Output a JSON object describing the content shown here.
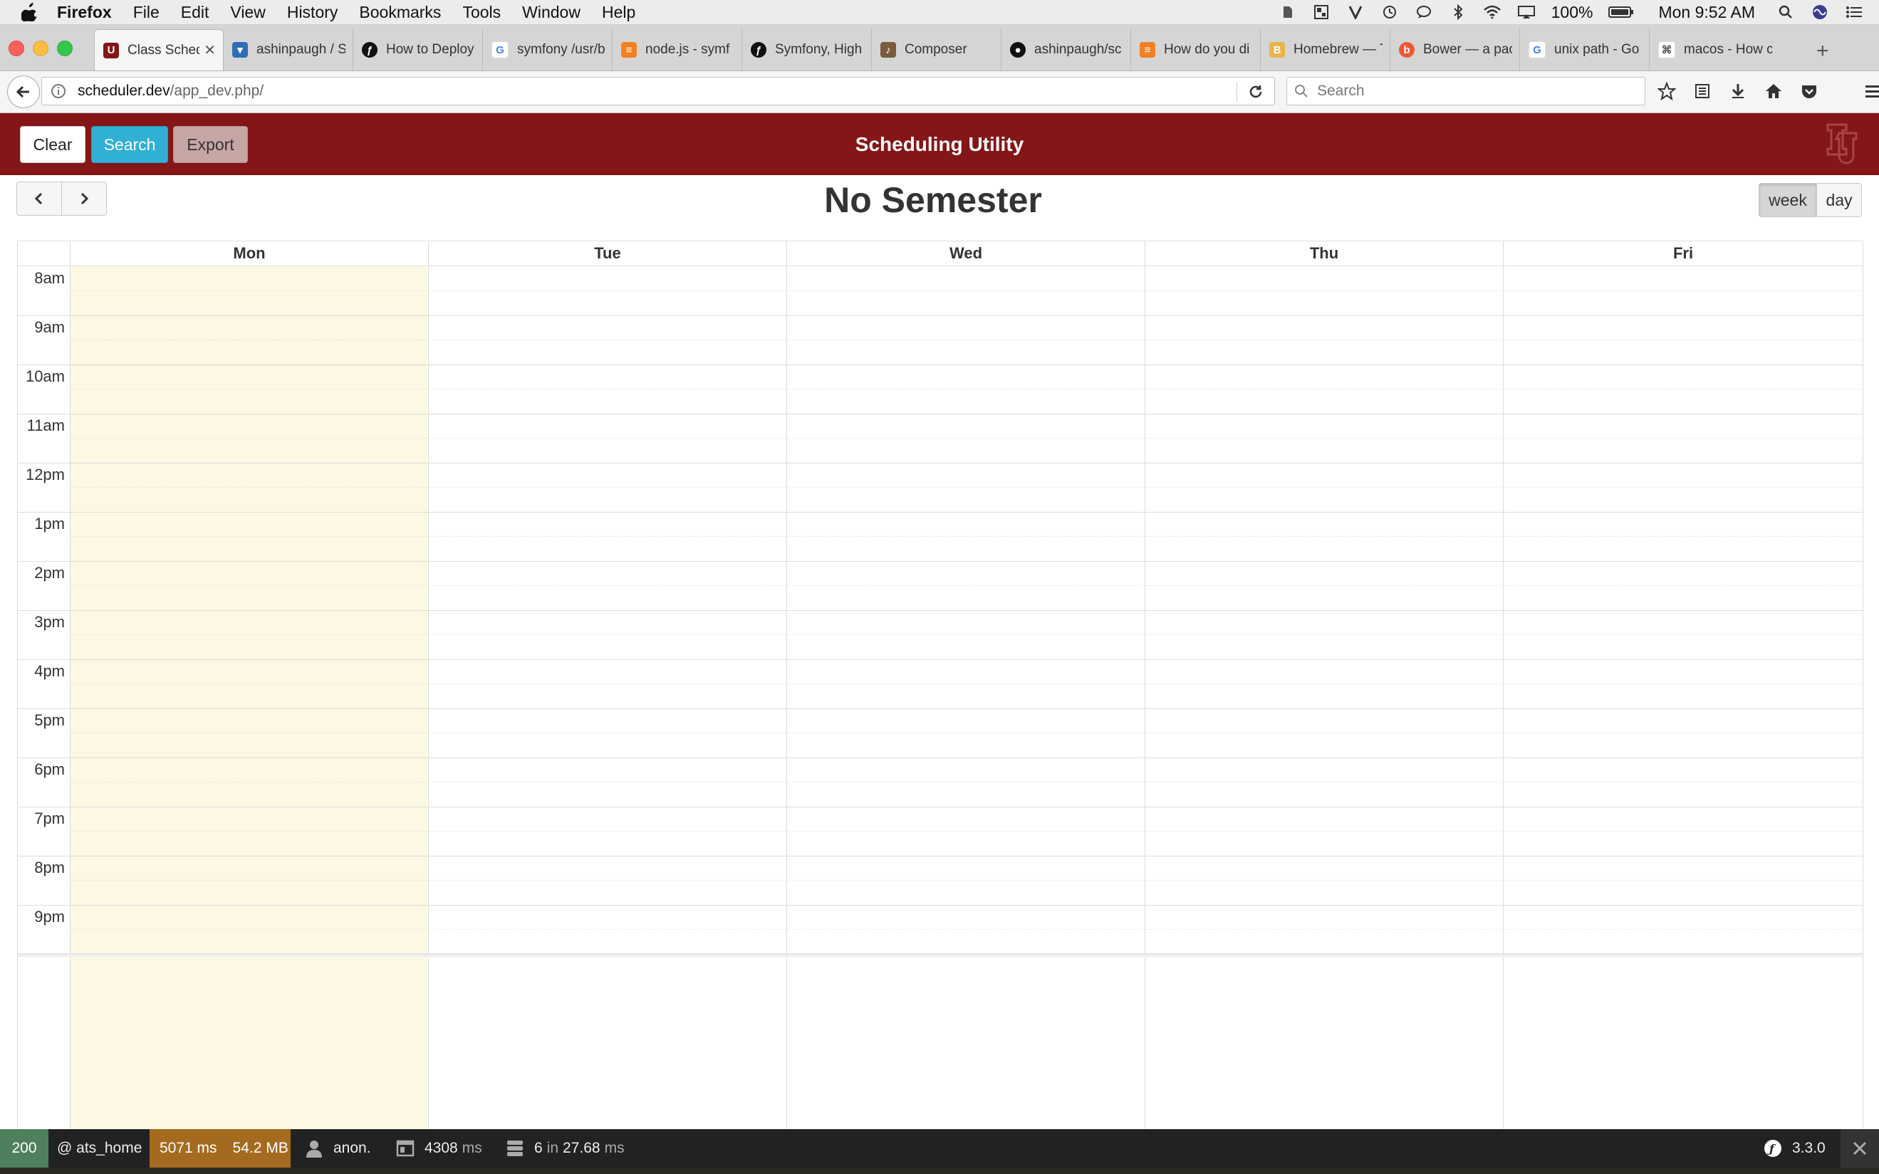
{
  "menubar": {
    "app": "Firefox",
    "items": [
      "File",
      "Edit",
      "View",
      "History",
      "Bookmarks",
      "Tools",
      "Window",
      "Help"
    ],
    "battery": "100%",
    "clock": "Mon 9:52 AM"
  },
  "tabs": [
    {
      "title": "Class Sched",
      "favicon": "ou-icon",
      "active": true
    },
    {
      "title": "ashinpaugh / S",
      "favicon": "bitbucket-icon"
    },
    {
      "title": "How to Deploy",
      "favicon": "symfony-icon"
    },
    {
      "title": "symfony /usr/b",
      "favicon": "google-icon"
    },
    {
      "title": "node.js - symf",
      "favicon": "stackoverflow-icon"
    },
    {
      "title": "Symfony, High",
      "favicon": "symfony-icon"
    },
    {
      "title": "Composer",
      "favicon": "composer-icon"
    },
    {
      "title": "ashinpaugh/sc",
      "favicon": "github-icon"
    },
    {
      "title": "How do you di",
      "favicon": "stackoverflow-icon"
    },
    {
      "title": "Homebrew — T",
      "favicon": "homebrew-icon"
    },
    {
      "title": "Bower — a pac",
      "favicon": "bower-icon"
    },
    {
      "title": "unix path - Go",
      "favicon": "google-icon"
    },
    {
      "title": "macos - How c",
      "favicon": "apple-se-icon"
    }
  ],
  "navbar": {
    "url_host": "scheduler.dev",
    "url_path": "/app_dev.php/",
    "search_placeholder": "Search"
  },
  "header": {
    "clear_label": "Clear",
    "search_label": "Search",
    "export_label": "Export",
    "title": "Scheduling Utility"
  },
  "calendar": {
    "title": "No Semester",
    "view_week": "week",
    "view_day": "day",
    "days": [
      "Mon",
      "Tue",
      "Wed",
      "Thu",
      "Fri"
    ],
    "times": [
      "8am",
      "9am",
      "10am",
      "11am",
      "12pm",
      "1pm",
      "2pm",
      "3pm",
      "4pm",
      "5pm",
      "6pm",
      "7pm",
      "8pm",
      "9pm"
    ],
    "highlight_color": "#fcf8e3"
  },
  "debug_toolbar": {
    "status": "200",
    "route": "@ ats_home",
    "time": "5071 ms",
    "memory": "54.2 MB",
    "user": "anon.",
    "form_time": "4308",
    "form_unit": "ms",
    "db_queries": "6",
    "db_in": "in",
    "db_time": "27.68",
    "db_unit": "ms",
    "version": "3.3.0"
  },
  "colors": {
    "brand": "#841617",
    "search_button": "#31b0d5"
  }
}
